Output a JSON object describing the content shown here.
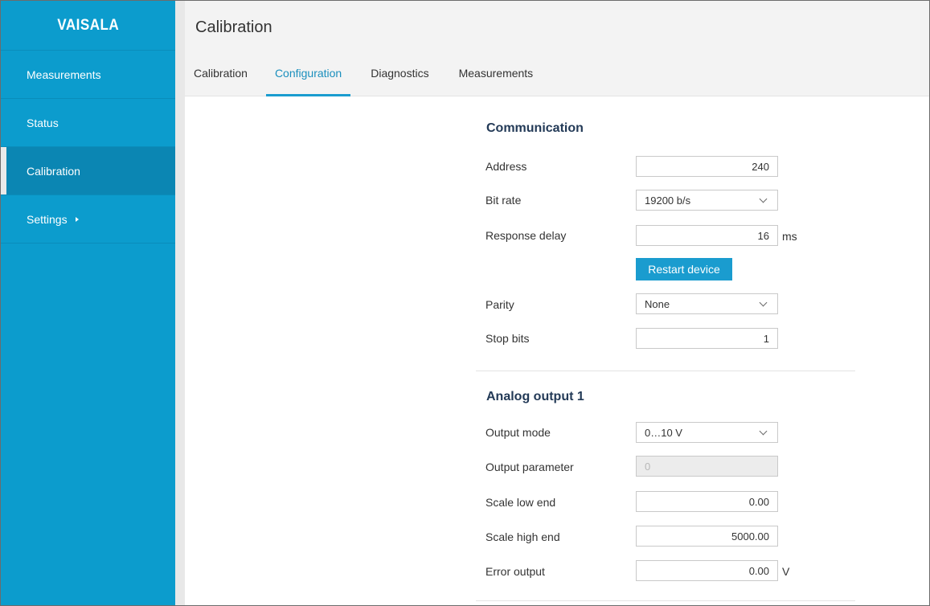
{
  "logo": "VAISALA",
  "sidebar": {
    "items": [
      {
        "label": "Measurements"
      },
      {
        "label": "Status"
      },
      {
        "label": "Calibration"
      },
      {
        "label": "Settings"
      }
    ]
  },
  "header": {
    "title": "Calibration"
  },
  "tabs": [
    {
      "label": "Calibration"
    },
    {
      "label": "Configuration"
    },
    {
      "label": "Diagnostics"
    },
    {
      "label": "Measurements"
    }
  ],
  "communication": {
    "title": "Communication",
    "address": {
      "label": "Address",
      "value": "240"
    },
    "bit_rate": {
      "label": "Bit rate",
      "value": "19200 b/s"
    },
    "response_delay": {
      "label": "Response delay",
      "value": "16",
      "unit": "ms"
    },
    "restart_button": "Restart device",
    "parity": {
      "label": "Parity",
      "value": "None"
    },
    "stop_bits": {
      "label": "Stop bits",
      "value": "1"
    }
  },
  "analog_output": {
    "title": "Analog output 1",
    "output_mode": {
      "label": "Output mode",
      "value": "0…10 V"
    },
    "output_parameter": {
      "label": "Output parameter",
      "value": "0"
    },
    "scale_low": {
      "label": "Scale low end",
      "value": "0.00"
    },
    "scale_high": {
      "label": "Scale high end",
      "value": "5000.00"
    },
    "error_output": {
      "label": "Error output",
      "value": "0.00",
      "unit": "V"
    }
  },
  "colors": {
    "sidebar": "#0c9ccd",
    "accent": "#1a9ccf",
    "section_title": "#233a57"
  }
}
